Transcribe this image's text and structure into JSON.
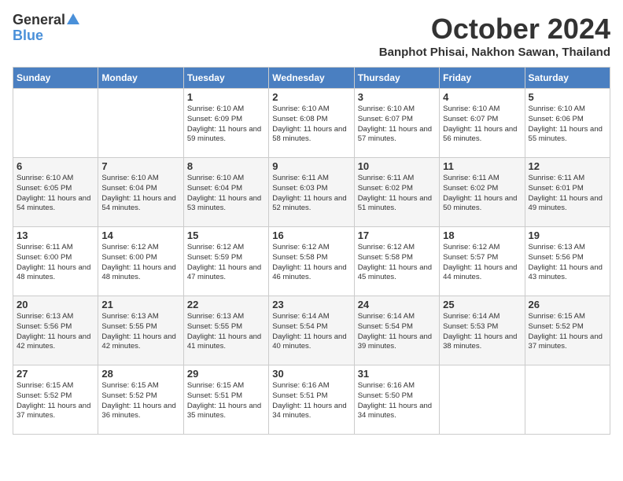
{
  "header": {
    "logo_general": "General",
    "logo_blue": "Blue",
    "month_title": "October 2024",
    "location": "Banphot Phisai, Nakhon Sawan, Thailand"
  },
  "days_of_week": [
    "Sunday",
    "Monday",
    "Tuesday",
    "Wednesday",
    "Thursday",
    "Friday",
    "Saturday"
  ],
  "weeks": [
    [
      {
        "day": "",
        "content": ""
      },
      {
        "day": "",
        "content": ""
      },
      {
        "day": "1",
        "content": "Sunrise: 6:10 AM\nSunset: 6:09 PM\nDaylight: 11 hours and 59 minutes."
      },
      {
        "day": "2",
        "content": "Sunrise: 6:10 AM\nSunset: 6:08 PM\nDaylight: 11 hours and 58 minutes."
      },
      {
        "day": "3",
        "content": "Sunrise: 6:10 AM\nSunset: 6:07 PM\nDaylight: 11 hours and 57 minutes."
      },
      {
        "day": "4",
        "content": "Sunrise: 6:10 AM\nSunset: 6:07 PM\nDaylight: 11 hours and 56 minutes."
      },
      {
        "day": "5",
        "content": "Sunrise: 6:10 AM\nSunset: 6:06 PM\nDaylight: 11 hours and 55 minutes."
      }
    ],
    [
      {
        "day": "6",
        "content": "Sunrise: 6:10 AM\nSunset: 6:05 PM\nDaylight: 11 hours and 54 minutes."
      },
      {
        "day": "7",
        "content": "Sunrise: 6:10 AM\nSunset: 6:04 PM\nDaylight: 11 hours and 54 minutes."
      },
      {
        "day": "8",
        "content": "Sunrise: 6:10 AM\nSunset: 6:04 PM\nDaylight: 11 hours and 53 minutes."
      },
      {
        "day": "9",
        "content": "Sunrise: 6:11 AM\nSunset: 6:03 PM\nDaylight: 11 hours and 52 minutes."
      },
      {
        "day": "10",
        "content": "Sunrise: 6:11 AM\nSunset: 6:02 PM\nDaylight: 11 hours and 51 minutes."
      },
      {
        "day": "11",
        "content": "Sunrise: 6:11 AM\nSunset: 6:02 PM\nDaylight: 11 hours and 50 minutes."
      },
      {
        "day": "12",
        "content": "Sunrise: 6:11 AM\nSunset: 6:01 PM\nDaylight: 11 hours and 49 minutes."
      }
    ],
    [
      {
        "day": "13",
        "content": "Sunrise: 6:11 AM\nSunset: 6:00 PM\nDaylight: 11 hours and 48 minutes."
      },
      {
        "day": "14",
        "content": "Sunrise: 6:12 AM\nSunset: 6:00 PM\nDaylight: 11 hours and 48 minutes."
      },
      {
        "day": "15",
        "content": "Sunrise: 6:12 AM\nSunset: 5:59 PM\nDaylight: 11 hours and 47 minutes."
      },
      {
        "day": "16",
        "content": "Sunrise: 6:12 AM\nSunset: 5:58 PM\nDaylight: 11 hours and 46 minutes."
      },
      {
        "day": "17",
        "content": "Sunrise: 6:12 AM\nSunset: 5:58 PM\nDaylight: 11 hours and 45 minutes."
      },
      {
        "day": "18",
        "content": "Sunrise: 6:12 AM\nSunset: 5:57 PM\nDaylight: 11 hours and 44 minutes."
      },
      {
        "day": "19",
        "content": "Sunrise: 6:13 AM\nSunset: 5:56 PM\nDaylight: 11 hours and 43 minutes."
      }
    ],
    [
      {
        "day": "20",
        "content": "Sunrise: 6:13 AM\nSunset: 5:56 PM\nDaylight: 11 hours and 42 minutes."
      },
      {
        "day": "21",
        "content": "Sunrise: 6:13 AM\nSunset: 5:55 PM\nDaylight: 11 hours and 42 minutes."
      },
      {
        "day": "22",
        "content": "Sunrise: 6:13 AM\nSunset: 5:55 PM\nDaylight: 11 hours and 41 minutes."
      },
      {
        "day": "23",
        "content": "Sunrise: 6:14 AM\nSunset: 5:54 PM\nDaylight: 11 hours and 40 minutes."
      },
      {
        "day": "24",
        "content": "Sunrise: 6:14 AM\nSunset: 5:54 PM\nDaylight: 11 hours and 39 minutes."
      },
      {
        "day": "25",
        "content": "Sunrise: 6:14 AM\nSunset: 5:53 PM\nDaylight: 11 hours and 38 minutes."
      },
      {
        "day": "26",
        "content": "Sunrise: 6:15 AM\nSunset: 5:52 PM\nDaylight: 11 hours and 37 minutes."
      }
    ],
    [
      {
        "day": "27",
        "content": "Sunrise: 6:15 AM\nSunset: 5:52 PM\nDaylight: 11 hours and 37 minutes."
      },
      {
        "day": "28",
        "content": "Sunrise: 6:15 AM\nSunset: 5:52 PM\nDaylight: 11 hours and 36 minutes."
      },
      {
        "day": "29",
        "content": "Sunrise: 6:15 AM\nSunset: 5:51 PM\nDaylight: 11 hours and 35 minutes."
      },
      {
        "day": "30",
        "content": "Sunrise: 6:16 AM\nSunset: 5:51 PM\nDaylight: 11 hours and 34 minutes."
      },
      {
        "day": "31",
        "content": "Sunrise: 6:16 AM\nSunset: 5:50 PM\nDaylight: 11 hours and 34 minutes."
      },
      {
        "day": "",
        "content": ""
      },
      {
        "day": "",
        "content": ""
      }
    ]
  ]
}
